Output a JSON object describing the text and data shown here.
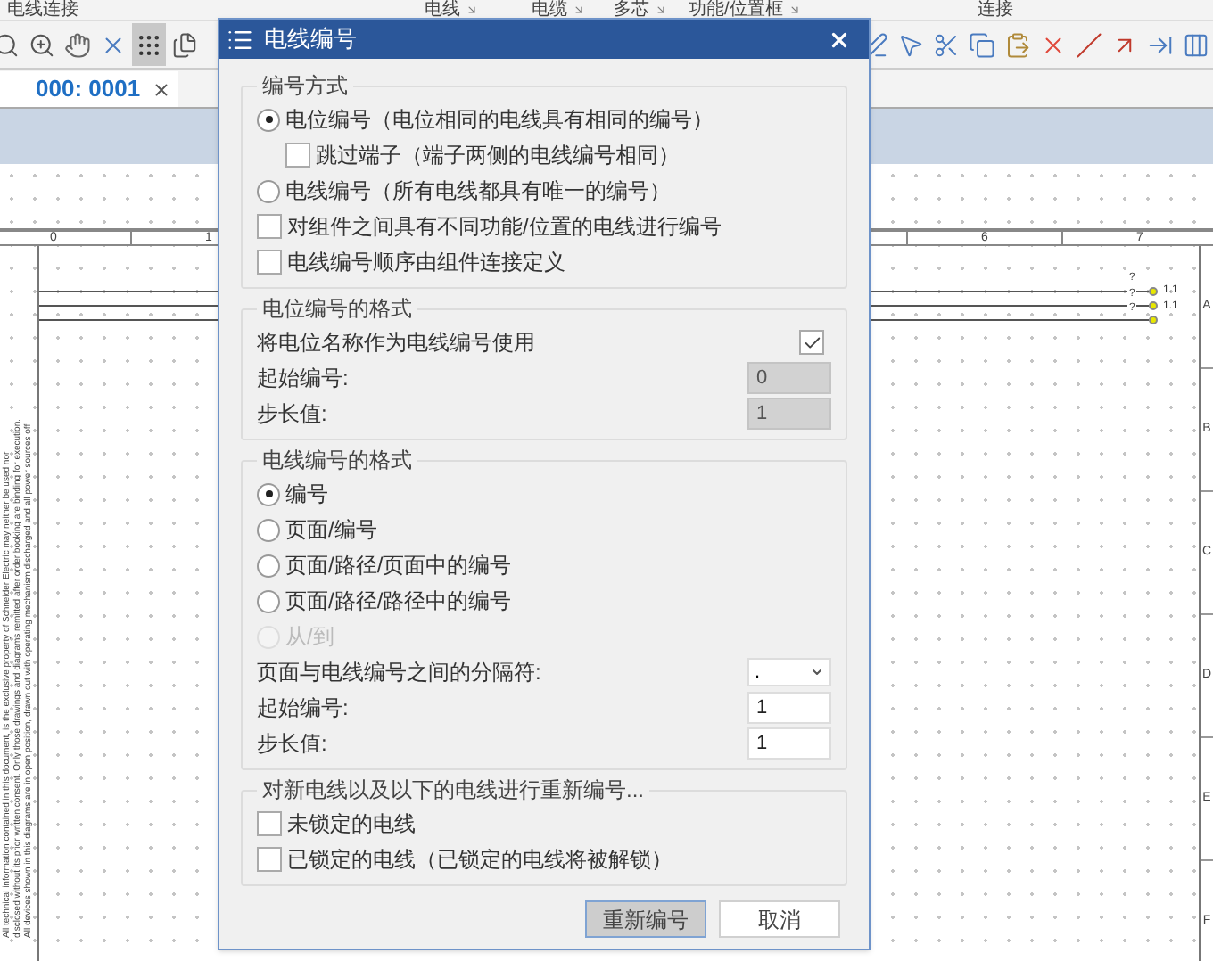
{
  "ribbon_groups": [
    {
      "label": "电线连接"
    },
    {
      "label": "电线"
    },
    {
      "label": "电缆"
    },
    {
      "label": "多芯"
    },
    {
      "label": "功能/位置框"
    },
    {
      "label": "连接"
    }
  ],
  "tools_left": [
    {
      "kind": "zoom",
      "selected": false
    },
    {
      "kind": "zoom-in",
      "selected": false
    },
    {
      "kind": "hand",
      "selected": false
    },
    {
      "kind": "cross",
      "selected": false
    },
    {
      "kind": "grid",
      "selected": true
    },
    {
      "kind": "pages",
      "selected": false
    }
  ],
  "tools_right": [
    {
      "kind": "pen",
      "selected": false
    },
    {
      "kind": "pointer",
      "selected": false
    },
    {
      "kind": "cut",
      "selected": false
    },
    {
      "kind": "copy",
      "selected": false
    },
    {
      "kind": "paste",
      "selected": false
    },
    {
      "kind": "delete",
      "selected": false
    },
    {
      "kind": "cut-wire",
      "selected": false
    },
    {
      "kind": "arrow",
      "selected": false
    },
    {
      "kind": "terminal",
      "selected": false
    },
    {
      "kind": "bars",
      "selected": false
    }
  ],
  "document_tab": {
    "label": "000: 0001",
    "selected": true
  },
  "ruler": {
    "columns": [
      "0",
      "1",
      "6",
      "7"
    ]
  },
  "rows": [
    "A",
    "B",
    "C",
    "D",
    "E",
    "F"
  ],
  "disclaimer": [
    "All technical information contained in this document, is the exclusive property of Schneider Electric may neither be used nor",
    "disclosed without its prior written consent. Only those drawings and diagrams remitted after order booking are binding for execution.",
    "All devices shown in this diagrams are in open position, drawn out with operating mechanism discharged and all power sources off."
  ],
  "wires": [
    {
      "label": "?",
      "number": "1.1"
    },
    {
      "label": "?",
      "number": "1.1"
    },
    {
      "label": "?"
    }
  ],
  "dialog": {
    "title": "电线编号",
    "groups": [
      {
        "title": "编号方式",
        "items": [
          {
            "kind": "radio",
            "label": "电位编号（电位相同的电线具有相同的编号）",
            "selected": true,
            "disabled": false,
            "children": [
              {
                "kind": "checkbox",
                "label": "跳过端子（端子两侧的电线编号相同）",
                "checked": false
              }
            ]
          },
          {
            "kind": "radio",
            "label": "电线编号（所有电线都具有唯一的编号）",
            "selected": false,
            "disabled": false
          },
          {
            "kind": "checkbox",
            "label": "对组件之间具有不同功能/位置的电线进行编号",
            "checked": false
          },
          {
            "kind": "checkbox",
            "label": "电线编号顺序由组件连接定义",
            "checked": false
          }
        ]
      },
      {
        "title": "电位编号的格式",
        "items": [
          {
            "kind": "check-right",
            "label": "将电位名称作为电线编号使用",
            "checked": true
          },
          {
            "kind": "field",
            "label": "起始编号:",
            "value": "0",
            "disabled": true
          },
          {
            "kind": "field",
            "label": "步长值:",
            "value": "1",
            "disabled": true
          }
        ]
      },
      {
        "title": "电线编号的格式",
        "items": [
          {
            "kind": "radio",
            "label": "编号",
            "selected": true,
            "disabled": false
          },
          {
            "kind": "radio",
            "label": "页面/编号",
            "selected": false,
            "disabled": false
          },
          {
            "kind": "radio",
            "label": "页面/路径/页面中的编号",
            "selected": false,
            "disabled": false
          },
          {
            "kind": "radio",
            "label": "页面/路径/路径中的编号",
            "selected": false,
            "disabled": false
          },
          {
            "kind": "radio",
            "label": "从/到",
            "selected": false,
            "disabled": true
          },
          {
            "kind": "dropdown",
            "label": "页面与电线编号之间的分隔符:",
            "value": "."
          },
          {
            "kind": "field",
            "label": "起始编号:",
            "value": "1",
            "disabled": false
          },
          {
            "kind": "field",
            "label": "步长值:",
            "value": "1",
            "disabled": false
          }
        ]
      },
      {
        "title": "对新电线以及以下的电线进行重新编号...",
        "items": [
          {
            "kind": "checkbox",
            "label": "未锁定的电线",
            "checked": false
          },
          {
            "kind": "checkbox",
            "label": "已锁定的电线（已锁定的电线将被解锁）",
            "checked": false
          }
        ]
      }
    ],
    "buttons": [
      {
        "label": "重新编号",
        "default": true
      },
      {
        "label": "取消",
        "default": false
      }
    ]
  }
}
